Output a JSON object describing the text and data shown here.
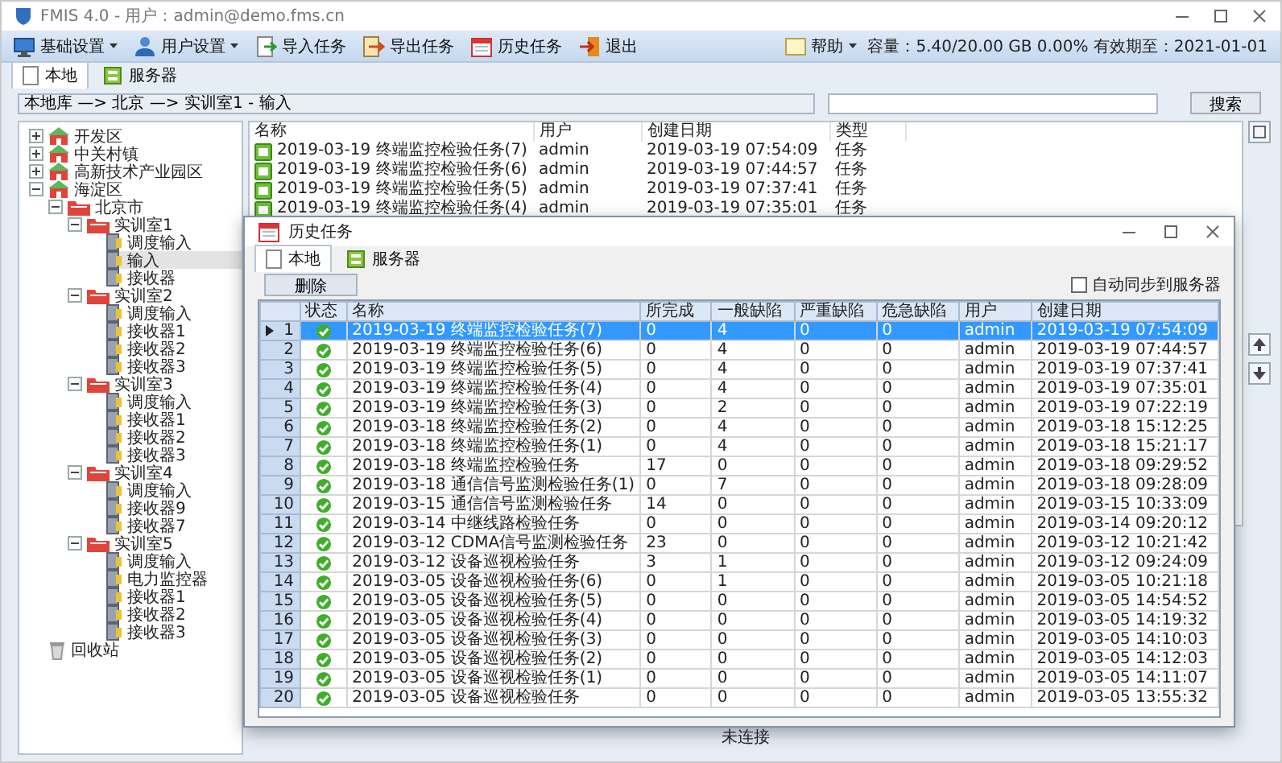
{
  "window": {
    "title": "FMIS 4.0 - 用户：admin@demo.fms.cn"
  },
  "toolbar": {
    "items": [
      {
        "label": "基础设置",
        "dropdown": true
      },
      {
        "label": "用户设置",
        "dropdown": true
      },
      {
        "label": "导入任务",
        "dropdown": false
      },
      {
        "label": "导出任务",
        "dropdown": false
      },
      {
        "label": "历史任务",
        "dropdown": false
      },
      {
        "label": "退出",
        "dropdown": false
      }
    ],
    "help": {
      "label": "帮助",
      "dropdown": true
    },
    "status": "容量：5.40/20.00 GB 0.00% 有效期至：2021-01-01"
  },
  "tabs": [
    {
      "label": "本地",
      "selected": true
    },
    {
      "label": "服务器",
      "selected": false
    }
  ],
  "path_bar": {
    "path": "本地库 —> 北京 —> 实训室1 - 输入",
    "search_button": "搜索"
  },
  "tree": [
    {
      "label": "开发区",
      "kind": "site",
      "expanded": false,
      "selected": false
    },
    {
      "label": "中关村镇",
      "kind": "site",
      "expanded": false,
      "selected": false
    },
    {
      "label": "高新技术产业园区",
      "kind": "site",
      "expanded": false,
      "selected": false
    },
    {
      "label": "海淀区",
      "kind": "site",
      "expanded": true,
      "selected": false,
      "children": [
        {
          "label": "北京市",
          "kind": "room",
          "expanded": true,
          "selected": false,
          "children": [
            {
              "label": "实训室1",
              "kind": "room",
              "expanded": true,
              "selected": false,
              "children": [
                {
                  "label": "调度输入",
                  "kind": "device",
                  "selected": false
                },
                {
                  "label": "输入",
                  "kind": "device",
                  "selected": true
                },
                {
                  "label": "接收器",
                  "kind": "device",
                  "selected": false
                }
              ]
            },
            {
              "label": "实训室2",
              "kind": "room",
              "expanded": true,
              "selected": false,
              "children": [
                {
                  "label": "调度输入",
                  "kind": "device",
                  "selected": false
                },
                {
                  "label": "接收器1",
                  "kind": "device",
                  "selected": false
                },
                {
                  "label": "接收器2",
                  "kind": "device",
                  "selected": false
                },
                {
                  "label": "接收器3",
                  "kind": "device",
                  "selected": false
                }
              ]
            },
            {
              "label": "实训室3",
              "kind": "room",
              "expanded": true,
              "selected": false,
              "children": [
                {
                  "label": "调度输入",
                  "kind": "device",
                  "selected": false
                },
                {
                  "label": "接收器1",
                  "kind": "device",
                  "selected": false
                },
                {
                  "label": "接收器2",
                  "kind": "device",
                  "selected": false
                },
                {
                  "label": "接收器3",
                  "kind": "device",
                  "selected": false
                }
              ]
            },
            {
              "label": "实训室4",
              "kind": "room",
              "expanded": true,
              "selected": false,
              "children": [
                {
                  "label": "调度输入",
                  "kind": "device",
                  "selected": false
                },
                {
                  "label": "接收器9",
                  "kind": "device",
                  "selected": false
                },
                {
                  "label": "接收器7",
                  "kind": "device",
                  "selected": false
                }
              ]
            },
            {
              "label": "实训室5",
              "kind": "room",
              "expanded": true,
              "selected": false,
              "children": [
                {
                  "label": "调度输入",
                  "kind": "device",
                  "selected": false
                },
                {
                  "label": "电力监控器",
                  "kind": "device",
                  "selected": false
                },
                {
                  "label": "接收器1",
                  "kind": "device",
                  "selected": false
                },
                {
                  "label": "接收器2",
                  "kind": "device",
                  "selected": false
                },
                {
                  "label": "接收器3",
                  "kind": "device",
                  "selected": false
                }
              ]
            }
          ]
        }
      ]
    },
    {
      "label": "回收站",
      "kind": "trash",
      "selected": false
    }
  ],
  "task_list": {
    "columns": [
      "名称",
      "用户",
      "创建日期",
      "类型"
    ],
    "rows": [
      {
        "name": "2019-03-19 终端监控检验任务(7)",
        "user": "admin",
        "date": "2019-03-19 07:54:09",
        "type": "任务"
      },
      {
        "name": "2019-03-19 终端监控检验任务(6)",
        "user": "admin",
        "date": "2019-03-19 07:44:57",
        "type": "任务"
      },
      {
        "name": "2019-03-19 终端监控检验任务(5)",
        "user": "admin",
        "date": "2019-03-19 07:37:41",
        "type": "任务"
      },
      {
        "name": "2019-03-19 终端监控检验任务(4)",
        "user": "admin",
        "date": "2019-03-19 07:35:01",
        "type": "任务"
      }
    ]
  },
  "status_label": "未连接",
  "dialog": {
    "title": "历史任务",
    "tabs": [
      {
        "label": "本地",
        "selected": true
      },
      {
        "label": "服务器",
        "selected": false
      }
    ],
    "delete_button": "删除",
    "auto_sync": {
      "label": "自动同步到服务器",
      "checked": false
    },
    "columns": [
      "状态",
      "名称",
      "所完成",
      "一般缺陷",
      "严重缺陷",
      "危急缺陷",
      "用户",
      "创建日期"
    ],
    "rows": [
      {
        "index": "1",
        "selected": true,
        "name": "2019-03-19 终端监控检验任务(7)",
        "done": "0",
        "minor": "4",
        "major": "0",
        "critical": "0",
        "user": "admin",
        "date": "2019-03-19 07:54:09"
      },
      {
        "index": "2",
        "selected": false,
        "name": "2019-03-19 终端监控检验任务(6)",
        "done": "0",
        "minor": "4",
        "major": "0",
        "critical": "0",
        "user": "admin",
        "date": "2019-03-19 07:44:57"
      },
      {
        "index": "3",
        "selected": false,
        "name": "2019-03-19 终端监控检验任务(5)",
        "done": "0",
        "minor": "4",
        "major": "0",
        "critical": "0",
        "user": "admin",
        "date": "2019-03-19 07:37:41"
      },
      {
        "index": "4",
        "selected": false,
        "name": "2019-03-19 终端监控检验任务(4)",
        "done": "0",
        "minor": "4",
        "major": "0",
        "critical": "0",
        "user": "admin",
        "date": "2019-03-19 07:35:01"
      },
      {
        "index": "5",
        "selected": false,
        "name": "2019-03-19 终端监控检验任务(3)",
        "done": "0",
        "minor": "2",
        "major": "0",
        "critical": "0",
        "user": "admin",
        "date": "2019-03-19 07:22:19"
      },
      {
        "index": "6",
        "selected": false,
        "name": "2019-03-18 终端监控检验任务(2)",
        "done": "0",
        "minor": "4",
        "major": "0",
        "critical": "0",
        "user": "admin",
        "date": "2019-03-18 15:12:25"
      },
      {
        "index": "7",
        "selected": false,
        "name": "2019-03-18 终端监控检验任务(1)",
        "done": "0",
        "minor": "4",
        "major": "0",
        "critical": "0",
        "user": "admin",
        "date": "2019-03-18 15:21:17"
      },
      {
        "index": "8",
        "selected": false,
        "name": "2019-03-18 终端监控检验任务",
        "done": "17",
        "minor": "0",
        "major": "0",
        "critical": "0",
        "user": "admin",
        "date": "2019-03-18 09:29:52"
      },
      {
        "index": "9",
        "selected": false,
        "name": "2019-03-18 通信信号监测检验任务(1)",
        "done": "0",
        "minor": "7",
        "major": "0",
        "critical": "0",
        "user": "admin",
        "date": "2019-03-18 09:28:09"
      },
      {
        "index": "10",
        "selected": false,
        "name": "2019-03-15 通信信号监测检验任务",
        "done": "14",
        "minor": "0",
        "major": "0",
        "critical": "0",
        "user": "admin",
        "date": "2019-03-15 10:33:09"
      },
      {
        "index": "11",
        "selected": false,
        "name": "2019-03-14 中继线路检验任务",
        "done": "0",
        "minor": "0",
        "major": "0",
        "critical": "0",
        "user": "admin",
        "date": "2019-03-14 09:20:12"
      },
      {
        "index": "12",
        "selected": false,
        "name": "2019-03-12 CDMA信号监测检验任务",
        "done": "23",
        "minor": "0",
        "major": "0",
        "critical": "0",
        "user": "admin",
        "date": "2019-03-12 10:21:42"
      },
      {
        "index": "13",
        "selected": false,
        "name": "2019-03-12 设备巡视检验任务",
        "done": "3",
        "minor": "1",
        "major": "0",
        "critical": "0",
        "user": "admin",
        "date": "2019-03-12 09:24:09"
      },
      {
        "index": "14",
        "selected": false,
        "name": "2019-03-05 设备巡视检验任务(6)",
        "done": "0",
        "minor": "1",
        "major": "0",
        "critical": "0",
        "user": "admin",
        "date": "2019-03-05 10:21:18"
      },
      {
        "index": "15",
        "selected": false,
        "name": "2019-03-05 设备巡视检验任务(5)",
        "done": "0",
        "minor": "0",
        "major": "0",
        "critical": "0",
        "user": "admin",
        "date": "2019-03-05 14:54:52"
      },
      {
        "index": "16",
        "selected": false,
        "name": "2019-03-05 设备巡视检验任务(4)",
        "done": "0",
        "minor": "0",
        "major": "0",
        "critical": "0",
        "user": "admin",
        "date": "2019-03-05 14:19:32"
      },
      {
        "index": "17",
        "selected": false,
        "name": "2019-03-05 设备巡视检验任务(3)",
        "done": "0",
        "minor": "0",
        "major": "0",
        "critical": "0",
        "user": "admin",
        "date": "2019-03-05 14:10:03"
      },
      {
        "index": "18",
        "selected": false,
        "name": "2019-03-05 设备巡视检验任务(2)",
        "done": "0",
        "minor": "0",
        "major": "0",
        "critical": "0",
        "user": "admin",
        "date": "2019-03-05 14:12:03"
      },
      {
        "index": "19",
        "selected": false,
        "name": "2019-03-05 设备巡视检验任务(1)",
        "done": "0",
        "minor": "0",
        "major": "0",
        "critical": "0",
        "user": "admin",
        "date": "2019-03-05 14:11:07"
      },
      {
        "index": "20",
        "selected": false,
        "name": "2019-03-05 设备巡视检验任务",
        "done": "0",
        "minor": "0",
        "major": "0",
        "critical": "0",
        "user": "admin",
        "date": "2019-03-05 13:55:32"
      }
    ]
  }
}
